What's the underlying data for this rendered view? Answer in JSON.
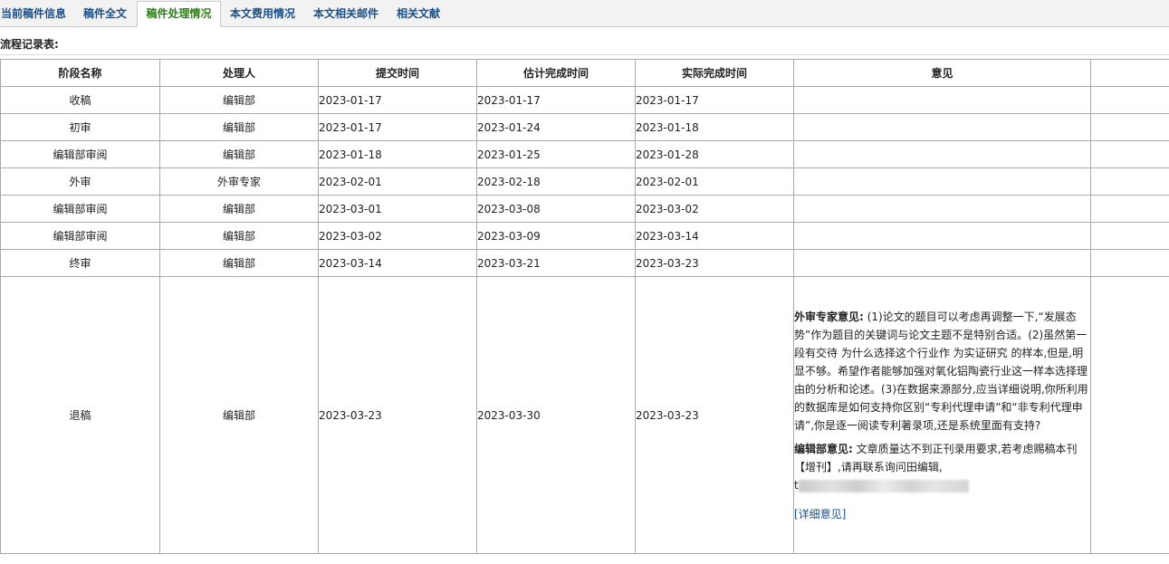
{
  "tabs": [
    {
      "label": "当前稿件信息",
      "active": false
    },
    {
      "label": "稿件全文",
      "active": false
    },
    {
      "label": "稿件处理情况",
      "active": true
    },
    {
      "label": "本文费用情况",
      "active": false
    },
    {
      "label": "本文相关邮件",
      "active": false
    },
    {
      "label": "相关文献",
      "active": false
    }
  ],
  "section_title": "流程记录表:",
  "table": {
    "headers": [
      "阶段名称",
      "处理人",
      "提交时间",
      "估计完成时间",
      "实际完成时间",
      "意见",
      ""
    ],
    "rows": [
      [
        "收稿",
        "编辑部",
        "2023-01-17",
        "2023-01-17",
        "2023-01-17"
      ],
      [
        "初审",
        "编辑部",
        "2023-01-17",
        "2023-01-24",
        "2023-01-18"
      ],
      [
        "编辑部审阅",
        "编辑部",
        "2023-01-18",
        "2023-01-25",
        "2023-01-28"
      ],
      [
        "外审",
        "外审专家",
        "2023-02-01",
        "2023-02-18",
        "2023-02-01"
      ],
      [
        "编辑部审阅",
        "编辑部",
        "2023-03-01",
        "2023-03-08",
        "2023-03-02"
      ],
      [
        "编辑部审阅",
        "编辑部",
        "2023-03-02",
        "2023-03-09",
        "2023-03-14"
      ],
      [
        "终审",
        "编辑部",
        "2023-03-14",
        "2023-03-21",
        "2023-03-23"
      ],
      [
        "退稿",
        "编辑部",
        "2023-03-23",
        "2023-03-30",
        "2023-03-23"
      ]
    ],
    "last_row_opinion": {
      "expert_label": "外审专家意见:",
      "expert_text": "(1)论文的题目可以考虑再调整一下,“发展态势”作为题目的关键词与论文主题不是特别合适。(2)虽然第一段有交待 为什么选择这个行业作 为实证研究 的样本,但是,明显不够。希望作者能够加强对氧化铝陶瓷行业这一样本选择理由的分析和论述。(3)在数据来源部分,应当详细说明,你所利用的数据库是如何支持你区别“专利代理申请”和“非专利代理申请”,你是逐一阅读专利著录项,还是系统里面有支持?",
      "editor_label": "编辑部意见:",
      "editor_text": "文章质量达不到正刊录用要求,若考虑赐稿本刊【增刊】,请再联系询问田编辑,",
      "contact_prefix": "t",
      "detail_link": "[详细意见]"
    }
  },
  "colors": {
    "tab_text": "#1a4f8a",
    "tab_active_text": "#2e7d1a",
    "tabbar_bg": "#f2f2f2",
    "border": "#aaaaaa"
  }
}
